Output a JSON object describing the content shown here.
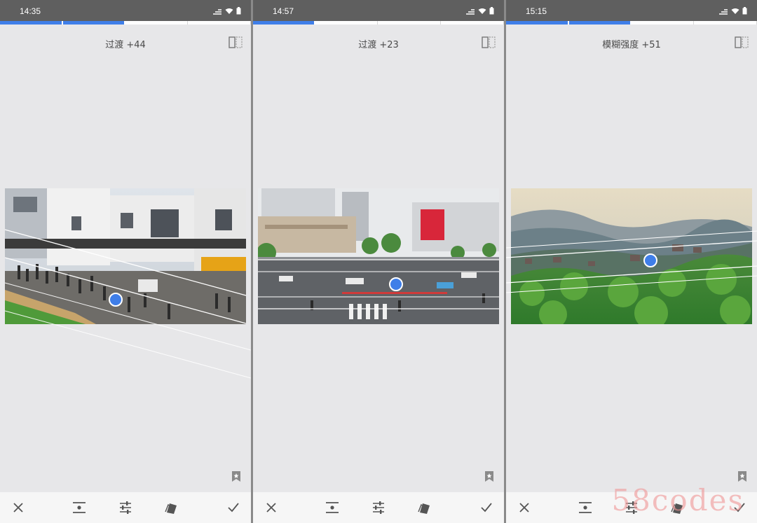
{
  "panels": [
    {
      "status_time": "14:35",
      "param_label": "过渡 +44",
      "progress_filled": 2
    },
    {
      "status_time": "14:57",
      "param_label": "过渡 +23",
      "progress_filled": 1
    },
    {
      "status_time": "15:15",
      "param_label": "模糊强度 +51",
      "progress_filled": 2
    }
  ],
  "toolbar_icons": [
    "close-icon",
    "tilt-shift-style-icon",
    "adjust-sliders-icon",
    "image-style-icon",
    "check-icon"
  ],
  "accent_color": "#3f7ee8",
  "watermark": "58codes"
}
